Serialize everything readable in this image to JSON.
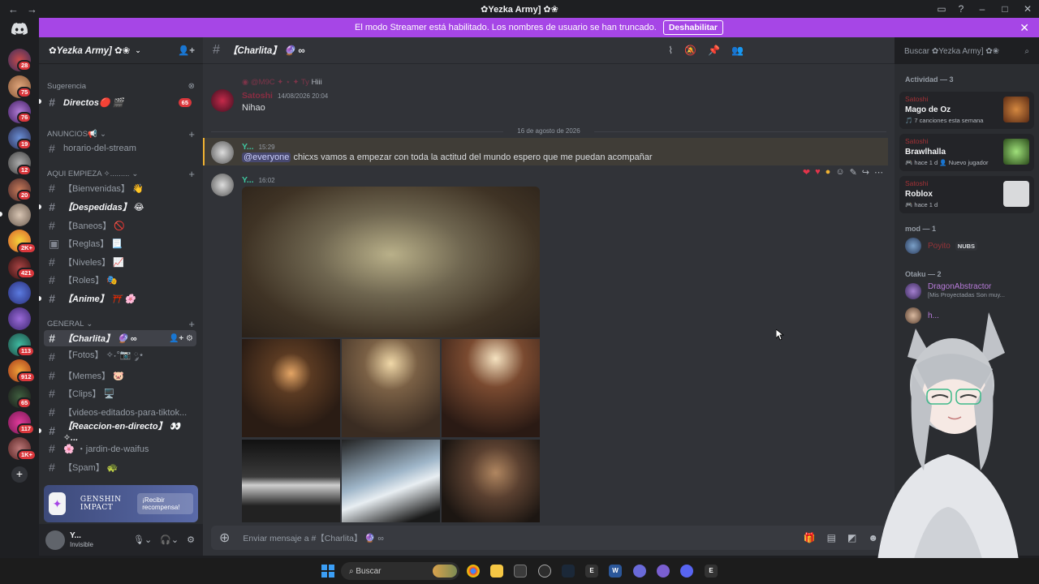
{
  "titlebar": {
    "title": "✿Yezka Army] ✿❀",
    "back": "←",
    "forward": "→"
  },
  "banner": {
    "text": "El modo Streamer está habilitado. Los nombres de usuario se han truncado.",
    "button": "Deshabilitar"
  },
  "rail": {
    "badges": [
      "28",
      "75",
      "76",
      "19",
      "12",
      "20",
      "2K+",
      "421",
      "113",
      "912",
      "65",
      "117",
      "1K+"
    ]
  },
  "sidebar": {
    "server_name": "✿Yezka Army] ✿❀",
    "categories": {
      "sugerencia": "Sugerencia",
      "anuncios": "ANUNCIOS📢",
      "aqui_empieza": "AQUI EMPIEZA ✧.........",
      "general": "GENERAL"
    },
    "channels": [
      {
        "label": "Directos🔴 🎬",
        "mention": "65"
      },
      {
        "label": "horario-del-stream"
      },
      {
        "label": "【Bienvenidas】 👋"
      },
      {
        "label": "【Despedidas】 😂"
      },
      {
        "label": "【Baneos】 🚫"
      },
      {
        "label": "【Reglas】 📃"
      },
      {
        "label": "【Niveles】 📈"
      },
      {
        "label": "【Roles】 🎭"
      },
      {
        "label": "【Anime】 ⛩️ 🌸"
      },
      {
        "label": "【Charlita】 🔮 ∞"
      },
      {
        "label": "【Fotos】 ✧˖°📷 ༘⋆"
      },
      {
        "label": "【Memes】 🐷"
      },
      {
        "label": "【Clips】 🖥️"
      },
      {
        "label": "【videos-editados-para-tiktok..."
      },
      {
        "label": "【Reaccion-en-directo】 👀 ✧..."
      },
      {
        "label": "🌸 ・jardin-de-waifus"
      },
      {
        "label": "【Spam】 🐢"
      }
    ],
    "promo": {
      "game": "GENSHIN IMPACT",
      "button": "¡Recibir recompensa!"
    },
    "user": {
      "name": "Y...",
      "status": "Invisible"
    }
  },
  "chat": {
    "channel_name": "【Charlita】 🔮 ∞",
    "search_placeholder": "Buscar ✿Yezka Army] ✿❀",
    "reply_text": "Hiii",
    "msg1": {
      "author": "Satoshi",
      "time": "14/08/2026 20:04",
      "text": "Nihao"
    },
    "date_divider": "16 de agosto de 2026",
    "msg2": {
      "author": "Y...",
      "time": "15:29",
      "mention": "@everyone",
      "text": " chicxs vamos a empezar con toda la actitud del mundo espero que me puedan acompañar"
    },
    "msg3": {
      "author": "Y...",
      "time": "16:02"
    },
    "composer_placeholder": "Enviar mensaje a #【Charlita】 🔮 ∞"
  },
  "members": {
    "activity_header": "Actividad — 3",
    "activities": [
      {
        "user": "Satoshi",
        "game": "Mago de Oz",
        "sub": "🎵 7 canciones esta semana"
      },
      {
        "user": "Satoshi",
        "game": "Brawlhalla",
        "sub": "🎮 hace 1 d  👤 Nuevo jugador"
      },
      {
        "user": "Satoshi",
        "game": "Roblox",
        "sub": "🎮 hace 1 d"
      }
    ],
    "mod_header": "mod — 1",
    "mod_member": {
      "name": "Poyito",
      "tag": "NUBS"
    },
    "otaku_header": "Otaku — 2",
    "otaku_members": [
      {
        "name": "DragonAbstractor",
        "status": "[Mis Proyectadas Son muy..."
      },
      {
        "name": "h..."
      }
    ]
  },
  "taskbar": {
    "search": "Buscar"
  },
  "colors": {
    "accent": "#a646e6",
    "bg": "#313338",
    "sidebar": "#2b2d31",
    "mention_red": "#da373c"
  }
}
